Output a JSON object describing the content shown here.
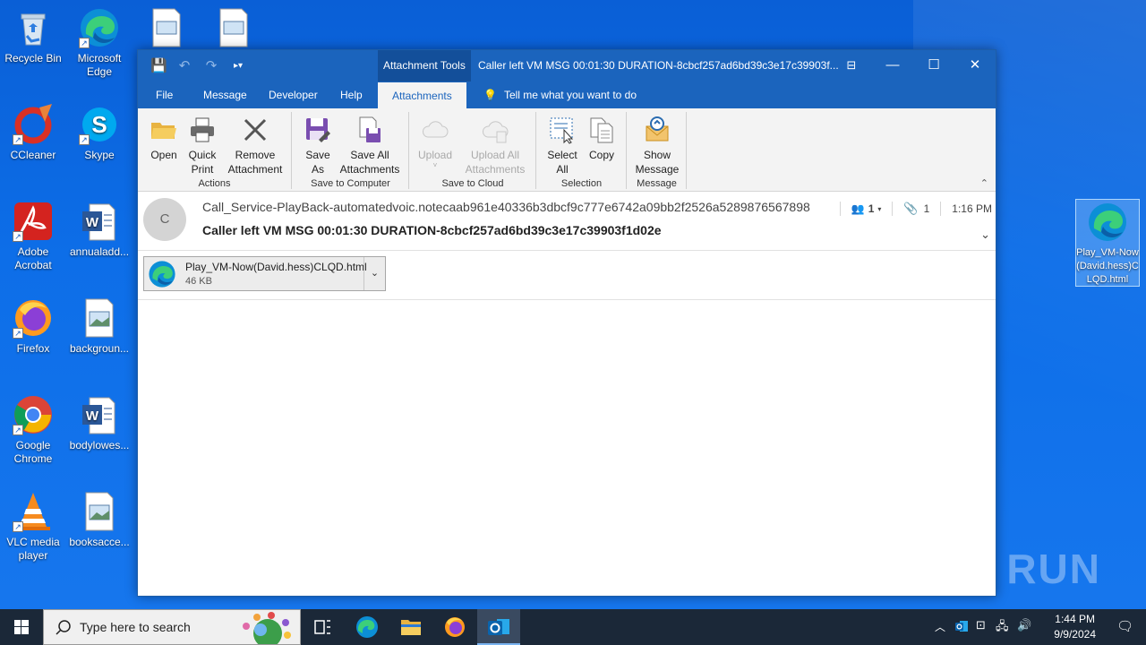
{
  "desktop": {
    "icons_left": [
      {
        "label": "Recycle Bin"
      },
      {
        "label": "CCleaner"
      },
      {
        "label": "Adobe Acrobat"
      },
      {
        "label": "Firefox"
      },
      {
        "label": "Google Chrome"
      },
      {
        "label": "VLC media player"
      }
    ],
    "icons_col2": [
      {
        "label": "Microsoft Edge"
      },
      {
        "label": "Skype"
      },
      {
        "label": "annualadd..."
      },
      {
        "label": "backgroun..."
      },
      {
        "label": "bodylowes..."
      },
      {
        "label": "booksacce..."
      }
    ],
    "icon_right": {
      "label": "Play_VM-Now(David.hess)CLQD.html"
    },
    "watermark": "ANY RUN"
  },
  "window": {
    "context_tab_label": "Attachment Tools",
    "title": "Caller left VM MSG 00:01:30 DURATION-8cbcf257ad6bd39c3e17c39903f...",
    "menu": [
      "File",
      "Message",
      "Developer",
      "Help",
      "Attachments"
    ],
    "active_menu": "Attachments",
    "tell_me": "Tell me what you want to do"
  },
  "ribbon": {
    "actions": {
      "label": "Actions",
      "open": "Open",
      "quick_print": "Quick Print",
      "remove_attachment": "Remove Attachment"
    },
    "save_to_computer": {
      "label": "Save to Computer",
      "save_as": "Save As",
      "save_all": "Save All Attachments"
    },
    "save_to_cloud": {
      "label": "Save to Cloud",
      "upload": "Upload",
      "upload_all": "Upload All Attachments"
    },
    "selection": {
      "label": "Selection",
      "select_all": "Select All",
      "copy": "Copy"
    },
    "message": {
      "label": "Message",
      "show_message": "Show Message"
    }
  },
  "message": {
    "avatar_initial": "C",
    "from": "Call_Service-PlayBack-automatedvoic.notecaab961e40336b3dbcf9c777e6742a09bb2f2526a5289876567898",
    "subject": "Caller left VM MSG 00:01:30 DURATION-8cbcf257ad6bd39c3e17c39903f1d02e",
    "people_count": "1",
    "attachment_count": "1",
    "time": "1:16 PM",
    "attachment": {
      "name": "Play_VM-Now(David.hess)CLQD.html",
      "size": "46 KB"
    }
  },
  "taskbar": {
    "search_placeholder": "Type here to search",
    "time": "1:44 PM",
    "date": "9/9/2024"
  },
  "colors": {
    "accent": "#1b64bd",
    "desktop": "#0d6ee8",
    "taskbar": "#1b2838"
  }
}
